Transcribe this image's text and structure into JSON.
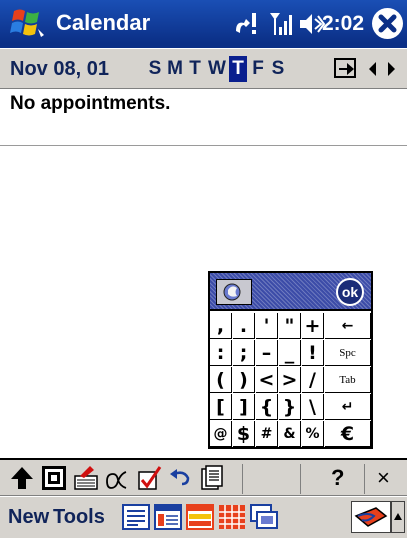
{
  "titlebar": {
    "title": "Calendar",
    "clock": "2:02",
    "icons": [
      "windows-start-icon",
      "connectivity-icon",
      "signal-icon",
      "volume-icon",
      "close-icon"
    ]
  },
  "datebar": {
    "date": "Nov 08, 01",
    "weekdays": [
      "S",
      "M",
      "T",
      "W",
      "T",
      "F",
      "S"
    ],
    "selected_weekday": "T",
    "icons": [
      "goto-today-icon",
      "arrow-left-icon",
      "arrow-right-icon"
    ]
  },
  "content": {
    "empty_message": "No appointments."
  },
  "symbol_panel": {
    "ok_label": "ok",
    "rows": [
      [
        ",",
        ".",
        "'",
        "\"",
        "+",
        "←"
      ],
      [
        ":",
        ";",
        "–",
        "_",
        "!",
        "Spc"
      ],
      [
        "(",
        ")",
        "<",
        ">",
        "/",
        "Tab"
      ],
      [
        "[",
        "]",
        "{",
        "}",
        "\\",
        "↵"
      ],
      [
        "@",
        "$",
        "#",
        "&",
        "%",
        "€"
      ]
    ]
  },
  "toolbar": {
    "help_label": "?",
    "close_label": "×",
    "icons": [
      "shift-up-icon",
      "keyboard-mode-icon",
      "recognize-icon",
      "alternates-icon",
      "checkbox-icon",
      "undo-icon",
      "properties-icon"
    ]
  },
  "menubar": {
    "new_label": "New",
    "tools_label": "Tools",
    "view_icons": [
      "agenda-view-icon",
      "day-view-icon",
      "week-view-icon",
      "month-view-icon",
      "year-view-icon"
    ]
  }
}
